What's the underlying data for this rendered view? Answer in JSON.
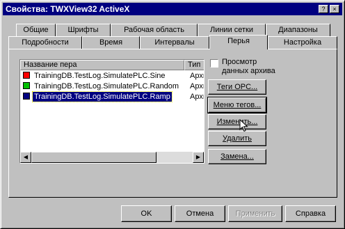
{
  "window": {
    "title": "Свойства: TWXView32 ActiveX",
    "help_icon": "?",
    "close_icon": "×"
  },
  "tabs_row1": [
    "Общие",
    "Шрифты",
    "Рабочая область",
    "Линии сетки",
    "Диапазоны"
  ],
  "tabs_row2": [
    "Подробности",
    "Время",
    "Интервалы",
    "Перья",
    "Настройка"
  ],
  "active_tab": "Перья",
  "pen_list": {
    "columns": [
      "Название пера",
      "Тип"
    ],
    "rows": [
      {
        "name": "TrainingDB.TestLog.SimulatePLC.Sine",
        "type": "Архи",
        "color": "#ff0000",
        "selected": false
      },
      {
        "name": "TrainingDB.TestLog.SimulatePLC.Random",
        "type": "Архи",
        "color": "#00c000",
        "selected": false
      },
      {
        "name": "TrainingDB.TestLog.SimulatePLC.Ramp",
        "type": "Архи",
        "color": "#000080",
        "selected": true
      }
    ]
  },
  "archive_checkbox": {
    "label": "Просмотр данных архива",
    "checked": false
  },
  "side_buttons": [
    "Теги OPC...",
    "Меню тегов...",
    "Изменить...",
    "Удалить",
    "Замена..."
  ],
  "footer_buttons": {
    "ok": "OK",
    "cancel": "Отмена",
    "apply": "Применить",
    "help": "Справка"
  }
}
